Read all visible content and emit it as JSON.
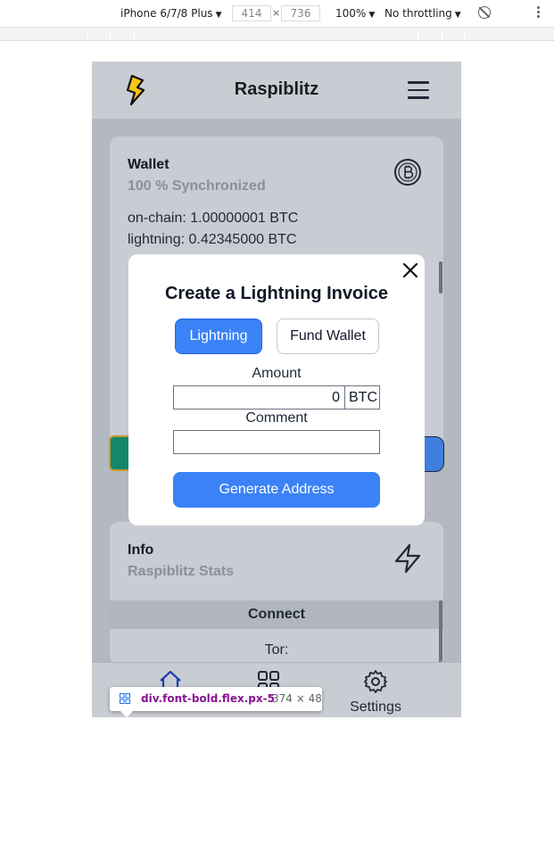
{
  "devtools": {
    "device": "iPhone 6/7/8 Plus",
    "width": "414",
    "height": "736",
    "separator": "×",
    "zoom": "100%",
    "throttling": "No throttling",
    "caret": "▼"
  },
  "app": {
    "title": "Raspiblitz",
    "logo_icon": "lightning-bolt-logo",
    "menu_icon": "hamburger-menu-icon"
  },
  "wallet": {
    "title": "Wallet",
    "subtitle": "100 % Synchronized",
    "onchain": "on-chain: 1.00000001 BTC",
    "lightning": "lightning: 0.42345000 BTC",
    "icon": "bitcoin-icon"
  },
  "info": {
    "title": "Info",
    "subtitle": "Raspiblitz Stats",
    "icon": "zap-icon",
    "connect_header": "Connect",
    "tor_label": "Tor:"
  },
  "bottom_nav": {
    "items": [
      {
        "icon": "home-icon",
        "label": ""
      },
      {
        "icon": "apps-icon",
        "label": ""
      },
      {
        "icon": "gear-icon",
        "label": "Settings"
      }
    ]
  },
  "modal": {
    "title": "Create a Lightning Invoice",
    "tab_lightning": "Lightning",
    "tab_fund": "Fund Wallet",
    "amount_label": "Amount",
    "amount_value": "0",
    "amount_unit": "BTC",
    "comment_label": "Comment",
    "comment_value": "",
    "generate_label": "Generate Address"
  },
  "inspect_tooltip": {
    "selector": "div.font-bold.flex.px-5",
    "size": "374 × 48"
  },
  "colors": {
    "primary": "#3b82f6",
    "header_bg": "#c9ccd2",
    "overlay_bg": "#b4b8c0",
    "selector_purple": "#881391"
  }
}
